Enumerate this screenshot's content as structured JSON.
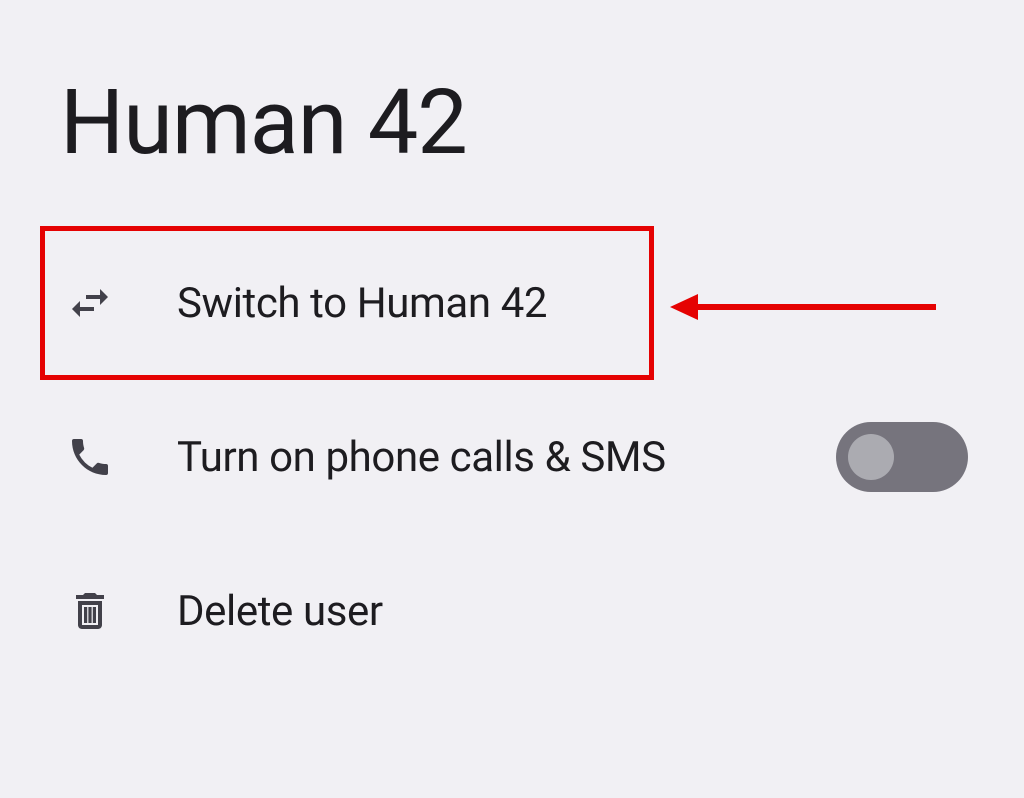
{
  "title": "Human 42",
  "items": {
    "switch": {
      "label": "Switch to Human 42"
    },
    "phone": {
      "label": "Turn on phone calls & SMS",
      "toggle": false
    },
    "delete": {
      "label": "Delete user"
    }
  },
  "annotation": {
    "highlight": "switch"
  }
}
